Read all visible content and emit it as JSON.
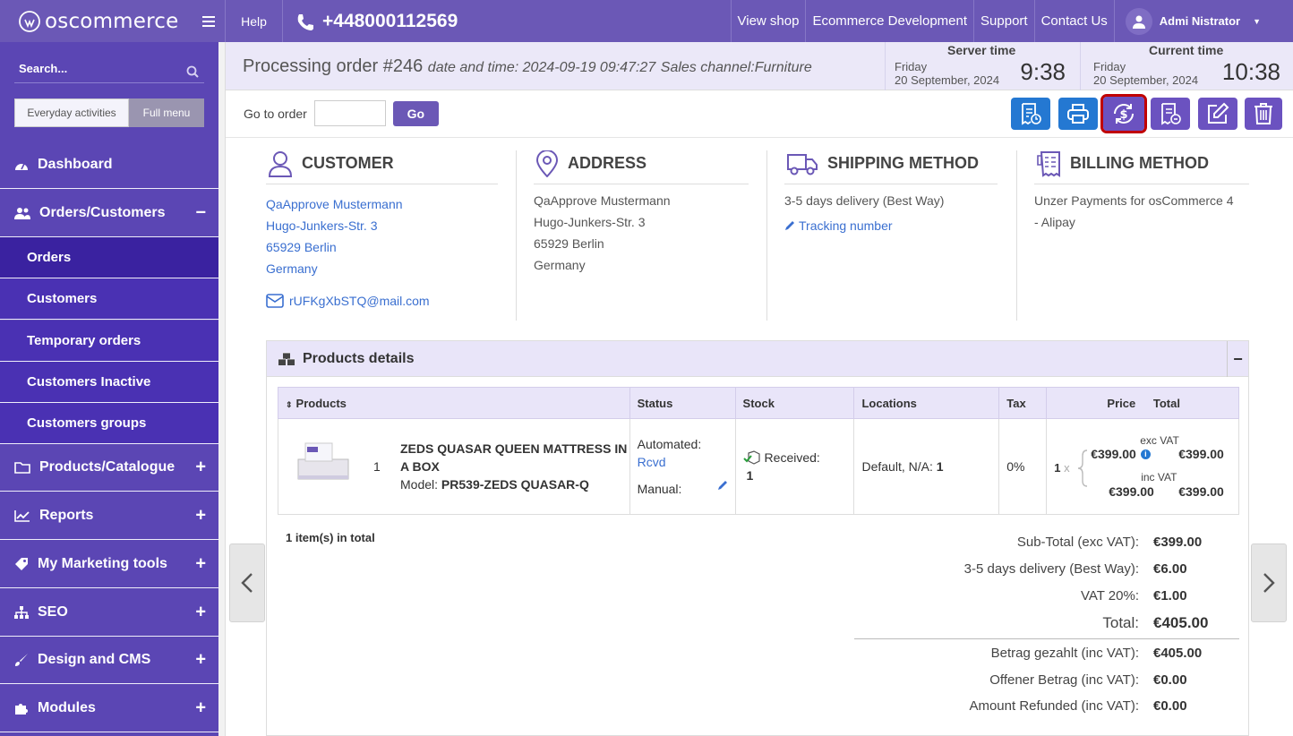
{
  "topbar": {
    "brand": "oscommerce",
    "help": "Help",
    "phone": "+448000112569",
    "links": [
      "View shop",
      "Ecommerce Development",
      "Support",
      "Contact Us"
    ],
    "user": "Admi Nistrator"
  },
  "sidebar": {
    "search_placeholder": "Search...",
    "mode_everyday": "Everyday activities",
    "mode_full": "Full menu",
    "items": {
      "dashboard": "Dashboard",
      "orders_customers": "Orders/Customers",
      "orders": "Orders",
      "customers": "Customers",
      "temporary_orders": "Temporary orders",
      "customers_inactive": "Customers Inactive",
      "customers_groups": "Customers groups",
      "products_catalogue": "Products/Catalogue",
      "reports": "Reports",
      "marketing": "My Marketing tools",
      "seo": "SEO",
      "design_cms": "Design and CMS",
      "modules": "Modules"
    }
  },
  "header": {
    "title": "Processing order #246",
    "datetime": "date and time: 2024-09-19 09:47:27",
    "channel": "Sales channel:Furniture",
    "server_label": "Server time",
    "server_day": "Friday",
    "server_date": "20 September, 2024",
    "server_time": "9:38",
    "current_label": "Current time",
    "current_day": "Friday",
    "current_date": "20 September, 2024",
    "current_time": "10:38"
  },
  "toolbar": {
    "goto_label": "Go to order",
    "go": "Go"
  },
  "customer": {
    "title": "CUSTOMER",
    "name": "QaApprove Mustermann",
    "street": "Hugo-Junkers-Str. 3",
    "city": "65929 Berlin",
    "country": "Germany",
    "email": "rUFKgXbSTQ@mail.com"
  },
  "address": {
    "title": "ADDRESS",
    "name": "QaApprove Mustermann",
    "street": "Hugo-Junkers-Str. 3",
    "city": "65929 Berlin",
    "country": "Germany"
  },
  "shipping": {
    "title": "SHIPPING METHOD",
    "method": "3-5 days delivery (Best Way)",
    "tracking": "Tracking number"
  },
  "billing": {
    "title": "BILLING METHOD",
    "line1": "Unzer Payments for osCommerce 4",
    "line2": "- Alipay"
  },
  "products": {
    "panel_title": "Products details",
    "headers": {
      "products": "Products",
      "status": "Status",
      "stock": "Stock",
      "locations": "Locations",
      "tax": "Tax",
      "price": "Price",
      "total": "Total"
    },
    "row": {
      "qty": "1",
      "name_line1": "ZEDS QUASAR QUEEN MATTRESS IN",
      "name_line2": "A BOX",
      "model_label": "Model:",
      "model": "PR539-ZEDS QUASAR-Q",
      "status_auto": "Automated:",
      "status_auto_val": "Rcvd",
      "status_manual": "Manual:",
      "stock_label": "Received:",
      "stock_val": "1",
      "location": "Default, N/A:",
      "location_qty": "1",
      "tax": "0%",
      "price_qty": "1",
      "price_x": "x",
      "exc_vat": "exc VAT",
      "price_exc": "€399.00",
      "total_exc": "€399.00",
      "inc_vat": "inc VAT",
      "price_inc": "€399.00",
      "total_inc": "€399.00"
    },
    "items_total": "1 item(s) in total"
  },
  "totals": [
    {
      "label": "Sub-Total (exc VAT):",
      "value": "€399.00"
    },
    {
      "label": "3-5 days delivery (Best Way):",
      "value": "€6.00"
    },
    {
      "label": "VAT 20%:",
      "value": "€1.00"
    },
    {
      "label": "Total:",
      "value": "€405.00"
    },
    {
      "label": "Betrag gezahlt (inc VAT):",
      "value": "€405.00"
    },
    {
      "label": "Offener Betrag (inc VAT):",
      "value": "€0.00"
    },
    {
      "label": "Amount Refunded (inc VAT):",
      "value": "€0.00"
    }
  ],
  "colors": {
    "brand": "#6b58b6",
    "sidebar": "#5b46b4",
    "active": "#3a22a0",
    "button_blue": "#2478d2",
    "link": "#3a6fd0",
    "highlight": "#c00000"
  },
  "icons": [
    "logo-icon",
    "menu-icon",
    "phone-icon",
    "user-icon",
    "search-icon",
    "dashboard-icon",
    "users-icon",
    "box-icon",
    "chart-icon",
    "tag-icon",
    "sitemap-icon",
    "brush-icon",
    "puzzle-icon",
    "invoice-icon",
    "print-icon",
    "refund-icon",
    "credit-note-icon",
    "edit-icon",
    "trash-icon",
    "person-icon",
    "map-pin-icon",
    "truck-icon",
    "receipt-icon",
    "mail-icon",
    "pencil-icon",
    "boxes-icon",
    "sort-icon",
    "stock-icon",
    "info-icon",
    "chevron-left-icon",
    "chevron-right-icon"
  ]
}
